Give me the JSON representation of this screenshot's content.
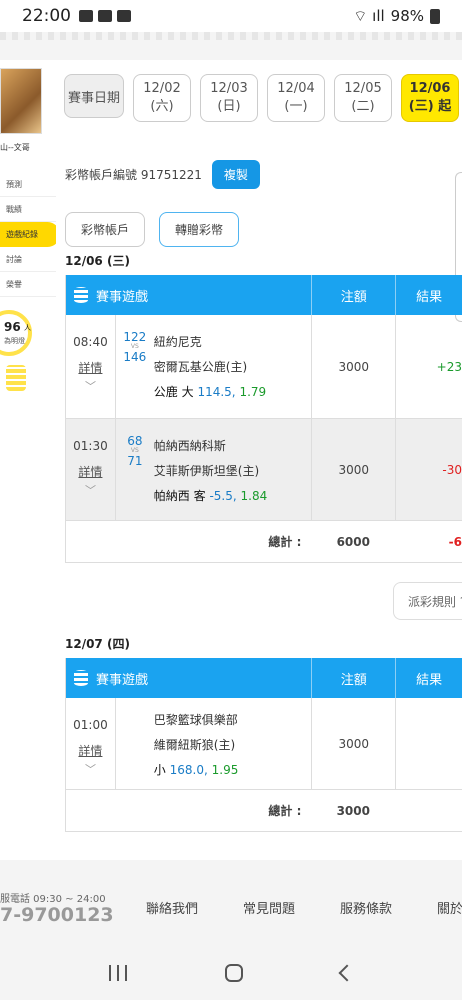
{
  "status_bar": {
    "time": "22:00",
    "battery": "98%"
  },
  "sidebar": {
    "user_name": "山--文哥",
    "items": [
      {
        "label": "預測"
      },
      {
        "label": "戰績"
      },
      {
        "label": "遊戲紀錄"
      },
      {
        "label": "討論"
      },
      {
        "label": "榮譽"
      }
    ],
    "stat_number": "96",
    "stat_unit": "人",
    "stat_desc": "為明燈"
  },
  "date_filter": {
    "label": "賽事日期",
    "dates": [
      {
        "date": "12/02",
        "weekday": "(六)",
        "active": false
      },
      {
        "date": "12/03",
        "weekday": "(日)",
        "active": false
      },
      {
        "date": "12/04",
        "weekday": "(一)",
        "active": false
      },
      {
        "date": "12/05",
        "weekday": "(二)",
        "active": false
      },
      {
        "date": "12/06",
        "weekday": "(三) 起",
        "active": true
      }
    ]
  },
  "account": {
    "label": "彩幣帳戶編號 91751221",
    "copy_label": "複製"
  },
  "sub_tabs": [
    {
      "label": "彩幣帳戶"
    },
    {
      "label": "轉贈彩幣"
    }
  ],
  "table_headers": {
    "game": "賽事遊戲",
    "amount": "注額",
    "result": "結果"
  },
  "days": [
    {
      "title": "12/06 (三)",
      "rows": [
        {
          "time": "08:40",
          "detail": "詳情",
          "score_a": "122",
          "vs": "VS",
          "score_b": "146",
          "team_a": "紐約尼克",
          "team_b": "密爾瓦基公鹿(主)",
          "pick_name": "公鹿 大",
          "pick_line": "114.5,",
          "pick_odds": "1.79",
          "amount": "3000",
          "result": "+23"
        },
        {
          "time": "01:30",
          "detail": "詳情",
          "score_a": "68",
          "vs": "VS",
          "score_b": "71",
          "team_a": "帕納西納科斯",
          "team_b": "艾菲斯伊斯坦堡(主)",
          "pick_name": "帕納西 客",
          "pick_line": "-5.5,",
          "pick_odds": "1.84",
          "amount": "3000",
          "result": "-30"
        }
      ],
      "total_label": "總計 :",
      "total_amount": "6000",
      "total_result": "-6"
    },
    {
      "title": "12/07 (四)",
      "rows": [
        {
          "time": "01:00",
          "detail": "詳情",
          "team_a": "巴黎籃球俱樂部",
          "team_b": "維爾紐斯狼(主)",
          "pick_name": "小",
          "pick_line": "168.0,",
          "pick_odds": "1.95",
          "amount": "3000",
          "result": ""
        }
      ],
      "total_label": "總計 :",
      "total_amount": "3000",
      "total_result": ""
    }
  ],
  "payout_rules": "派彩規則 ?",
  "footer": {
    "hours": "服電話 09:30 ~ 24:00",
    "phone": "7-9700123",
    "links": [
      "聯絡我們",
      "常見問題",
      "服務條款",
      "關於"
    ]
  }
}
